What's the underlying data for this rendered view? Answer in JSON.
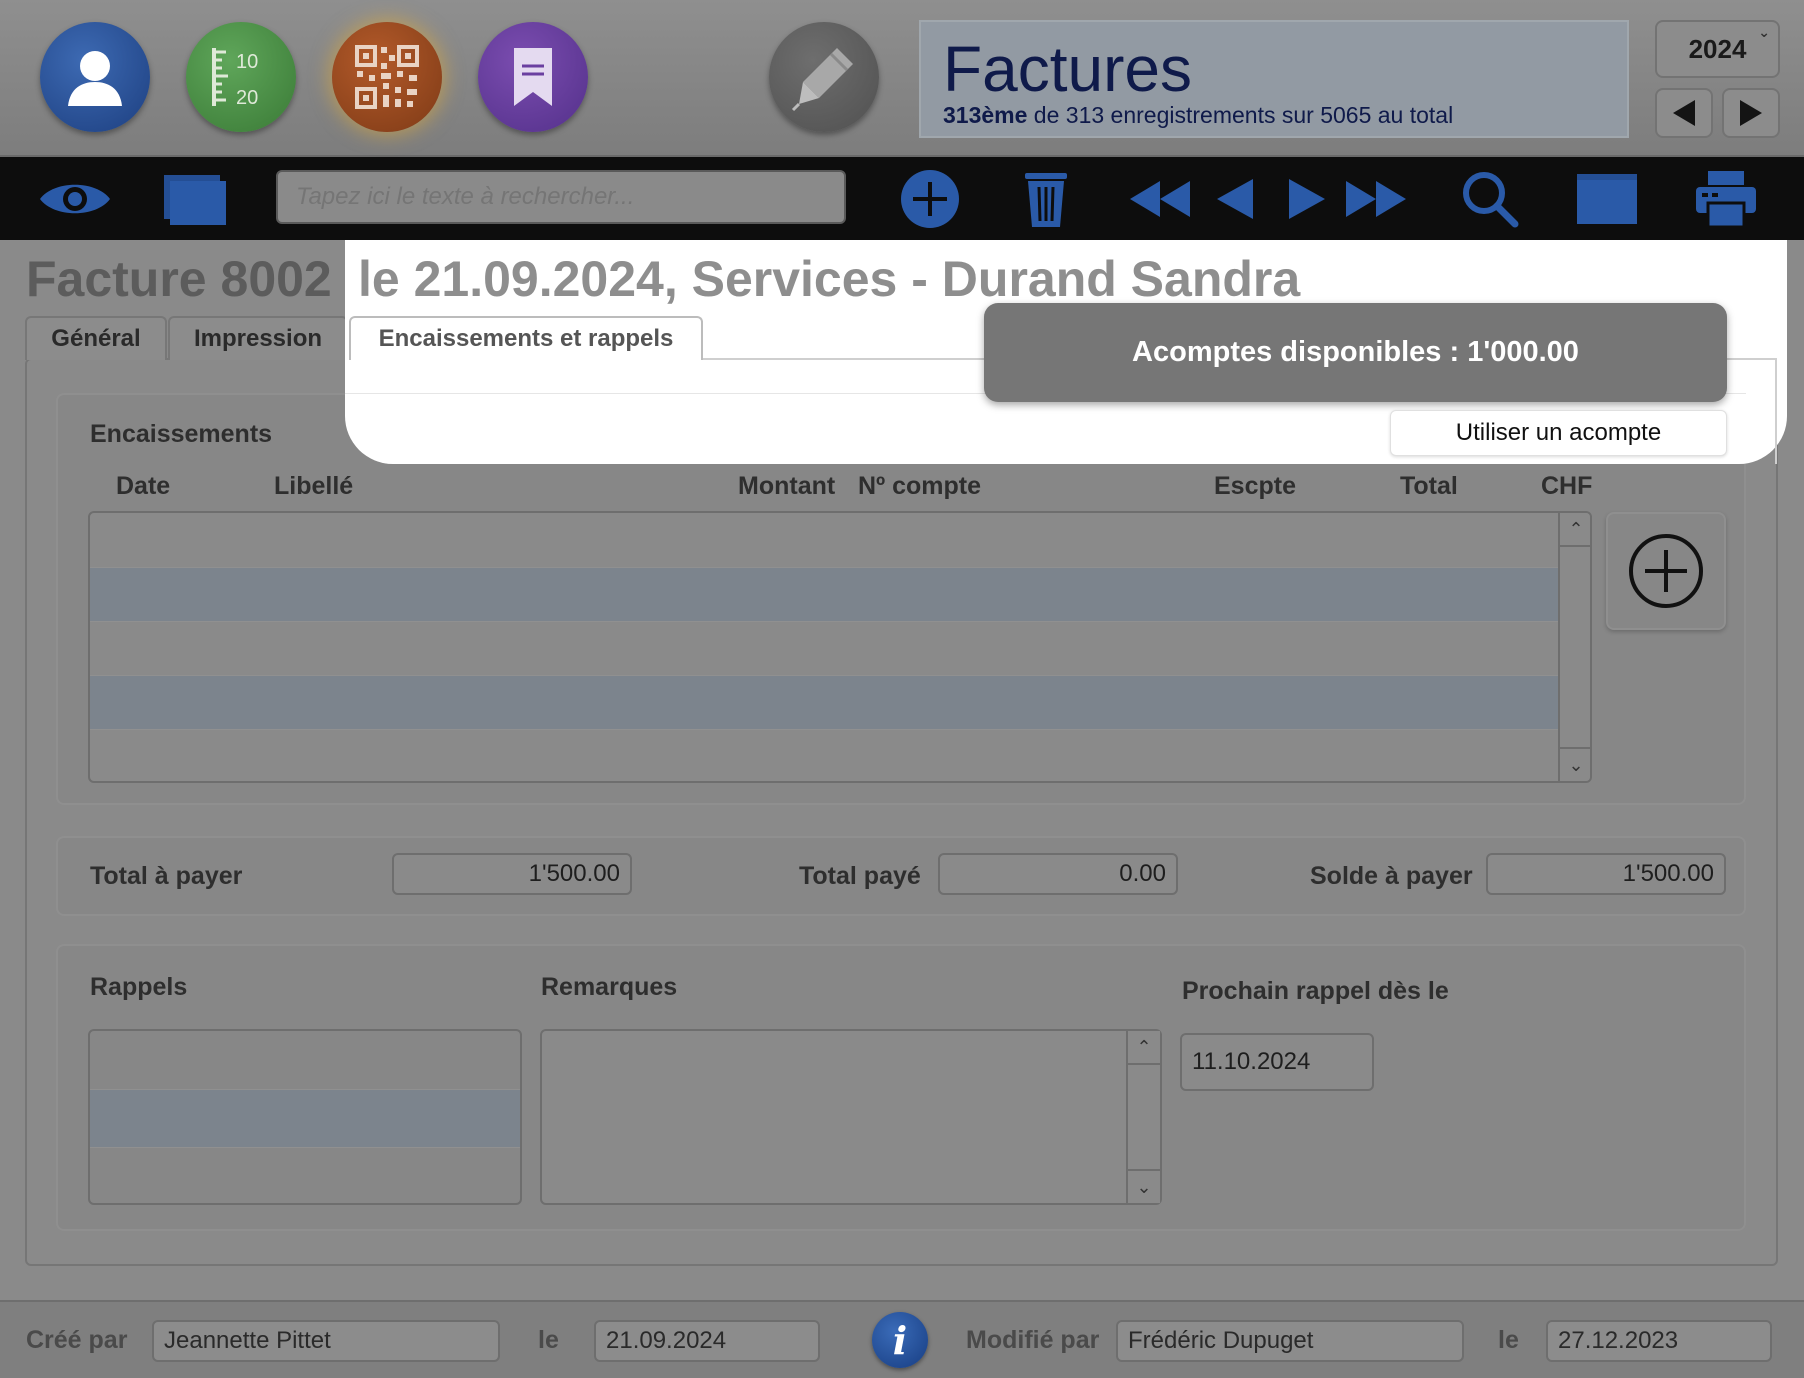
{
  "header": {
    "title": "Factures",
    "subtitle_bold": "313ème",
    "subtitle_rest": " de 313 enregistrements sur 5065 au total",
    "year": "2024",
    "numbers_icon_top": "10",
    "numbers_icon_bottom": "20"
  },
  "toolbar": {
    "search_placeholder": "Tapez ici le texte à rechercher..."
  },
  "record": {
    "title_left": "Facture 8002",
    "title_right": " le 21.09.2024, Services - Durand Sandra"
  },
  "tabs": [
    {
      "label": "Général"
    },
    {
      "label": "Impression"
    },
    {
      "label": "Encaissements et rappels"
    }
  ],
  "deposits": {
    "banner": "Acomptes disponibles : 1'000.00",
    "button": "Utiliser un acompte"
  },
  "encaissements": {
    "label": "Encaissements",
    "columns": [
      "Date",
      "Libellé",
      "Montant",
      "Nº compte",
      "Escpte",
      "Total",
      "CHF"
    ]
  },
  "totals": {
    "total_label": "Total à payer",
    "total_value": "1'500.00",
    "paid_label": "Total payé",
    "paid_value": "0.00",
    "balance_label": "Solde à payer",
    "balance_value": "1'500.00"
  },
  "rappels": {
    "label": "Rappels",
    "remarks_label": "Remarques",
    "next_label": "Prochain rappel dès le",
    "next_value": "11.10.2024"
  },
  "footer": {
    "created_label": "Créé par",
    "created_by": "Jeannette Pittet",
    "on_label": "le",
    "created_on": "21.09.2024",
    "modified_label": "Modifié par",
    "modified_by": "Frédéric Dupuget",
    "modified_on": "27.12.2023",
    "info_glyph": "i"
  },
  "colors": {
    "title_navy": "#0f1a4a",
    "accent_blue": "#2a5aa8",
    "row_alt": "#7c848d"
  }
}
